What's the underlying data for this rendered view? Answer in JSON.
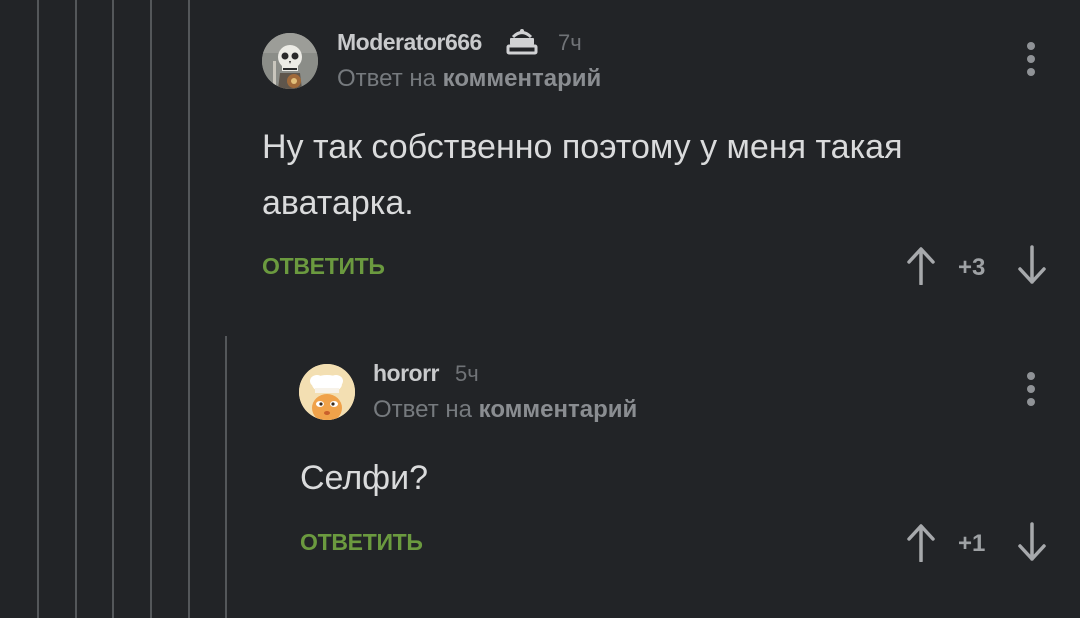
{
  "thread_icons": [
    "thread-line-icon"
  ],
  "comments": [
    {
      "username": "Moderator666",
      "badge_icon": "cake-icon",
      "time": "7ч",
      "reply_prefix": "Ответ на",
      "reply_target": "комментарий",
      "text": "Ну так собственно поэтому у меня такая аватарка.",
      "reply_label": "ОТВЕТИТЬ",
      "score": "+3",
      "avatar_icon": "skeleton-avatar-icon"
    },
    {
      "username": "hororr",
      "time": "5ч",
      "reply_prefix": "Ответ на",
      "reply_target": "комментарий",
      "text": "Селфи?",
      "reply_label": "ОТВЕТИТЬ",
      "score": "+1",
      "avatar_icon": "chef-avatar-icon"
    }
  ],
  "colors": {
    "background": "#222427",
    "accent_green": "#6b9a3f",
    "muted_text": "#767a7e"
  }
}
